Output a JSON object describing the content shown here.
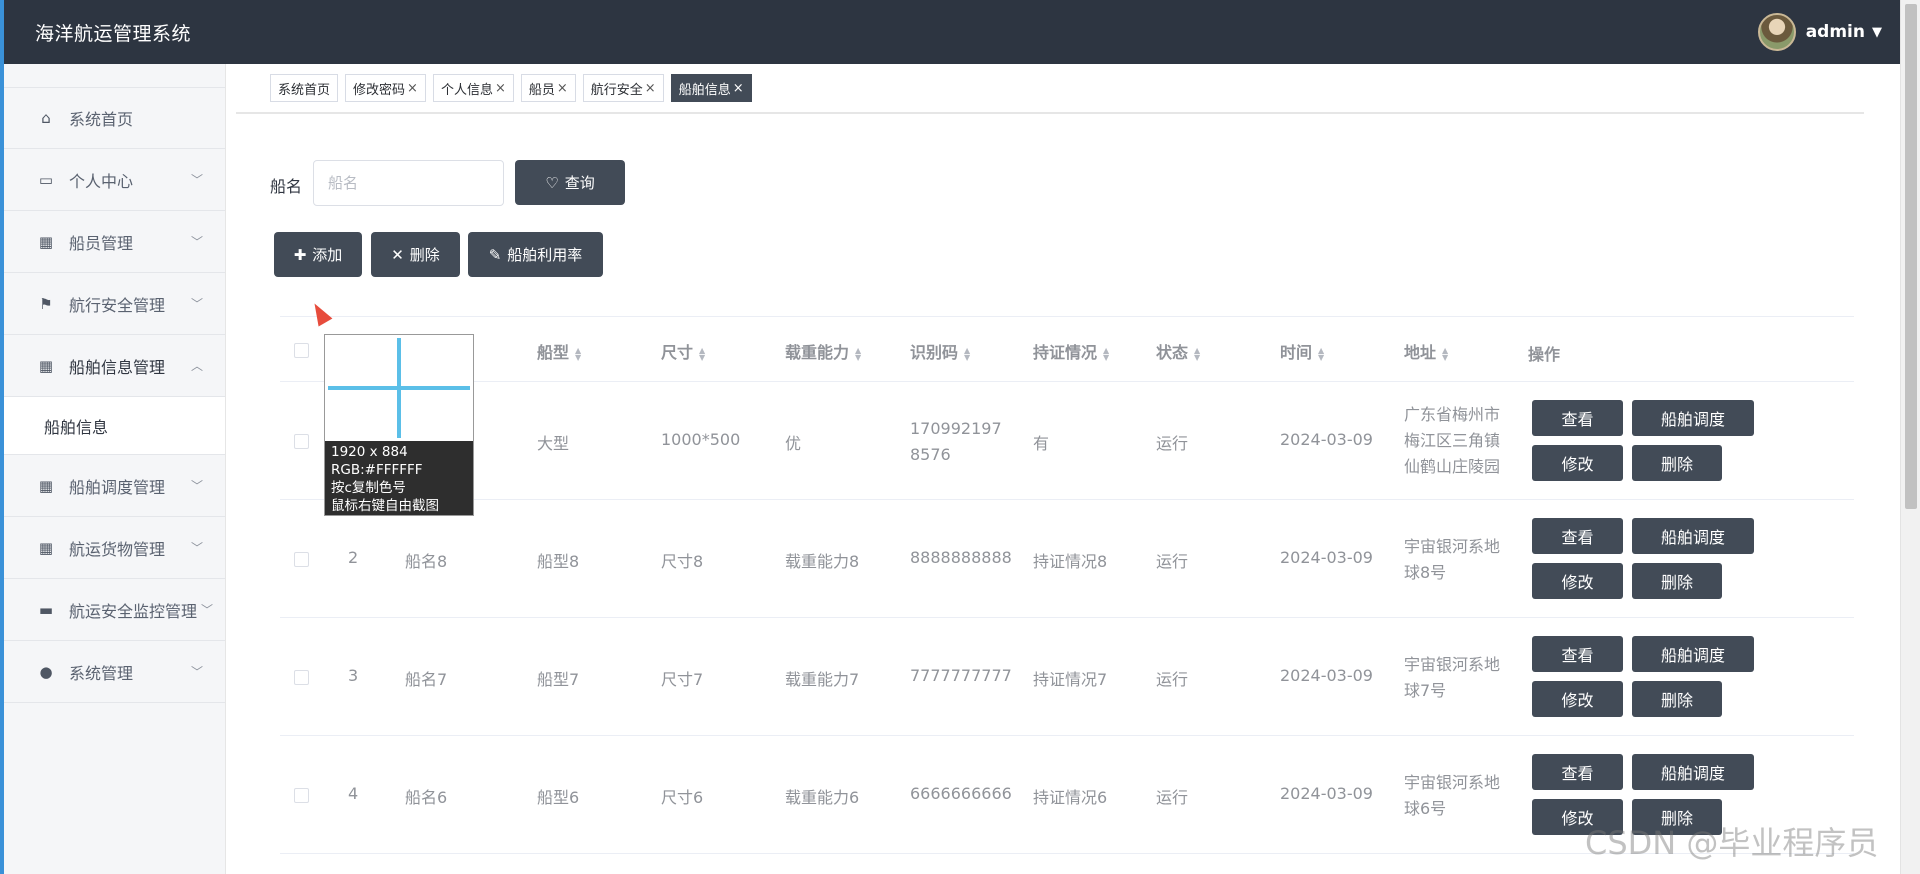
{
  "header": {
    "title": "海洋航运管理系统",
    "username": "admin"
  },
  "sidebar": {
    "items": [
      {
        "label": "系统首页",
        "icon": "home-icon",
        "glyph": "⌂"
      },
      {
        "label": "个人中心",
        "icon": "card-icon",
        "glyph": "▭"
      },
      {
        "label": "船员管理",
        "icon": "grid-icon",
        "glyph": "▦"
      },
      {
        "label": "航行安全管理",
        "icon": "flag-icon",
        "glyph": "⚑"
      },
      {
        "label": "船舶信息管理",
        "icon": "grid-icon",
        "glyph": "▦"
      },
      {
        "label": "船舶调度管理",
        "icon": "grid-icon",
        "glyph": "▦"
      },
      {
        "label": "航运货物管理",
        "icon": "apps-icon",
        "glyph": "▦"
      },
      {
        "label": "航运安全监控管理",
        "icon": "briefcase-icon",
        "glyph": "▬"
      },
      {
        "label": "系统管理",
        "icon": "bulb-icon",
        "glyph": "●"
      }
    ],
    "sub_item": "船舶信息"
  },
  "tabs": [
    {
      "label": "系统首页",
      "closable": false
    },
    {
      "label": "修改密码",
      "closable": true
    },
    {
      "label": "个人信息",
      "closable": true
    },
    {
      "label": "船员",
      "closable": true
    },
    {
      "label": "航行安全",
      "closable": true
    },
    {
      "label": "船舶信息",
      "closable": true,
      "active": true
    }
  ],
  "tab_close": "×",
  "search": {
    "label": "船名",
    "placeholder": "船名",
    "button": "查询"
  },
  "toolbar": {
    "add": "添加",
    "delete": "删除",
    "utilization": "船舶利用率"
  },
  "table": {
    "headers": [
      "船型",
      "尺寸",
      "载重能力",
      "识别码",
      "持证情况",
      "状态",
      "时间",
      "地址",
      "操作"
    ],
    "rows": [
      {
        "index": "",
        "name": "",
        "type": "大型",
        "size": "1000*500",
        "capacity": "优",
        "code": "1709921978576",
        "cert": "有",
        "status": "运行",
        "time": "2024-03-09",
        "address": "广东省梅州市梅江区三角镇仙鹤山庄陵园"
      },
      {
        "index": "2",
        "name": "船名8",
        "type": "船型8",
        "size": "尺寸8",
        "capacity": "载重能力8",
        "code": "8888888888",
        "cert": "持证情况8",
        "status": "运行",
        "time": "2024-03-09",
        "address": "宇宙银河系地球8号"
      },
      {
        "index": "3",
        "name": "船名7",
        "type": "船型7",
        "size": "尺寸7",
        "capacity": "载重能力7",
        "code": "7777777777",
        "cert": "持证情况7",
        "status": "运行",
        "time": "2024-03-09",
        "address": "宇宙银河系地球7号"
      },
      {
        "index": "4",
        "name": "船名6",
        "type": "船型6",
        "size": "尺寸6",
        "capacity": "载重能力6",
        "code": "6666666666",
        "cert": "持证情况6",
        "status": "运行",
        "time": "2024-03-09",
        "address": "宇宙银河系地球6号"
      }
    ],
    "actions": {
      "view": "查看",
      "dispatch": "船舶调度",
      "edit": "修改",
      "delete": "删除"
    }
  },
  "picker": {
    "line1": "1920 x 884",
    "line2": "RGB:#FFFFFF",
    "line3": "按c复制色号",
    "line4": "鼠标右键自由截图"
  },
  "watermark": "CSDN @毕业程序员",
  "colors": {
    "header_bg": "#2d3541",
    "accent": "#424b57",
    "crosshair": "#5bbfe8"
  }
}
